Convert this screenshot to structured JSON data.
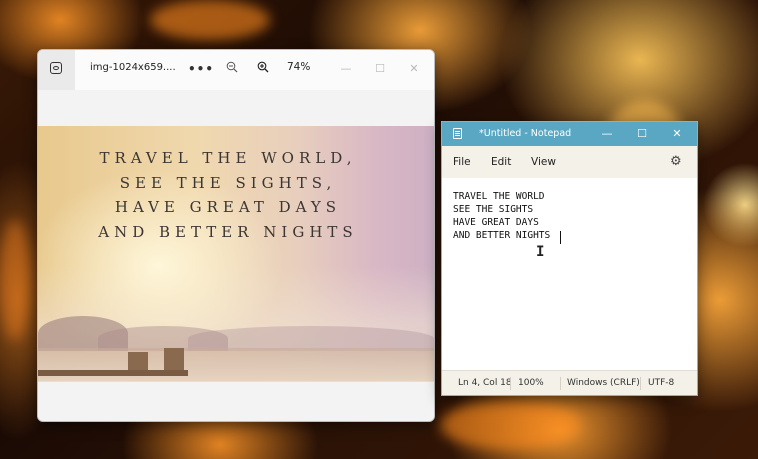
{
  "photos": {
    "file_tab": "img-1024x659....",
    "more_icon": "ellipsis-icon",
    "zoom_out_icon": "zoom-out-icon",
    "zoom_in_icon": "zoom-in-icon",
    "zoom_level": "74%",
    "image_text": [
      "TRAVEL THE WORLD,",
      "SEE THE SIGHTS,",
      "HAVE GREAT DAYS",
      "AND BETTER NIGHTS"
    ]
  },
  "notepad": {
    "title": "*Untitled - Notepad",
    "menu": {
      "file": "File",
      "edit": "Edit",
      "view": "View"
    },
    "content": [
      "TRAVEL THE WORLD",
      "SEE THE SIGHTS",
      "HAVE GREAT DAYS",
      "AND BETTER NIGHTS"
    ],
    "status": {
      "position": "Ln 4, Col 18",
      "zoom": "100%",
      "line_ending": "Windows (CRLF)",
      "encoding": "UTF-8"
    }
  },
  "colors": {
    "notepad_titlebar": "#5aa7c3",
    "notepad_menu_bg": "#f4f1e8",
    "desktop_fire": "#f08a20"
  }
}
